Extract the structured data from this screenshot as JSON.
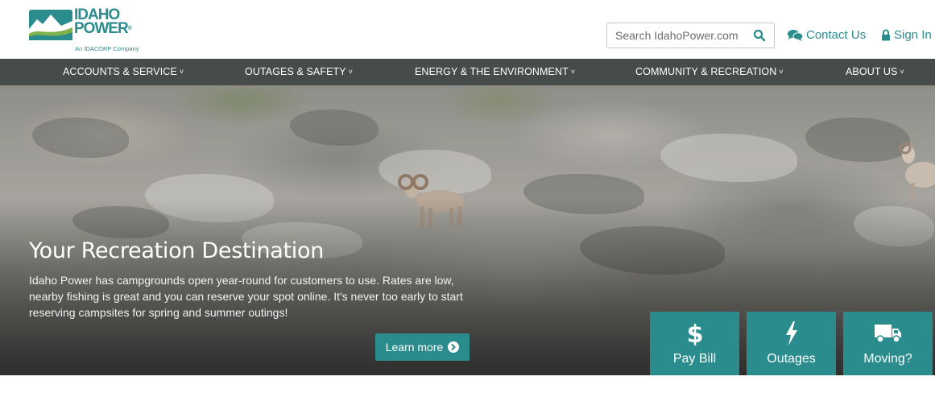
{
  "brand": {
    "name_line1": "IDAHO",
    "name_line2": "POWER",
    "registered": "®",
    "tagline": "An IDACORP Company",
    "logo_icon": "mountain-river-logo-icon",
    "color": "#2a8c8c"
  },
  "header": {
    "search": {
      "placeholder": "Search IdahoPower.com",
      "icon": "search-icon"
    },
    "contact_label": "Contact Us",
    "contact_icon": "chat-bubbles-icon",
    "signin_label": "Sign In",
    "signin_icon": "lock-icon"
  },
  "nav": {
    "items": [
      {
        "label": "ACCOUNTS & SERVICE"
      },
      {
        "label": "OUTAGES & SAFETY"
      },
      {
        "label": "ENERGY & THE ENVIRONMENT"
      },
      {
        "label": "COMMUNITY & RECREATION"
      },
      {
        "label": "ABOUT US"
      }
    ],
    "chevron": "˅",
    "background": "#474b4a"
  },
  "hero": {
    "title": "Your Recreation Destination",
    "text": "Idaho Power has campgrounds open year-round for customers to use. Rates are low, nearby fishing is great and you can reserve your spot online. It's never too early to start reserving campsites for spring and summer outings!",
    "button_label": "Learn more",
    "button_icon": "arrow-circle-right-icon"
  },
  "quick_links": [
    {
      "label": "Pay Bill",
      "icon": "dollar-icon"
    },
    {
      "label": "Outages",
      "icon": "lightning-bolt-icon"
    },
    {
      "label": "Moving?",
      "icon": "truck-icon"
    }
  ],
  "colors": {
    "accent": "#2a8c8c",
    "nav": "#474b4a"
  }
}
